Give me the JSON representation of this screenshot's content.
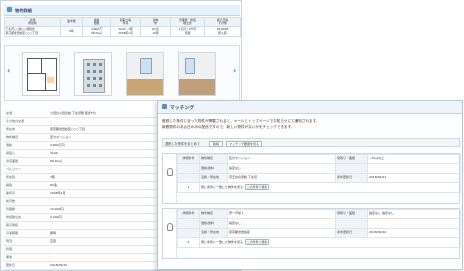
{
  "back_panel": {
    "title": "物件詳細",
    "summary_headers": [
      "交通\n所在地",
      "築年数",
      "価格\n面積",
      "間取り等\n年月",
      "建物\n他",
      "管理費・修繕\n積立金",
      "販売日等\nその他"
    ],
    "summary_values": [
      "下北沢○○線○○駅徒歩\n東京都世田谷区○○○丁目",
      "8年",
      "4,800万\n68.00㎡",
      "3LDK / 3階\n2008年1月",
      "RC造\n10階",
      "1万円 / 9千円\n月額",
      "2018/09\n即入居"
    ],
    "detail_rows": [
      {
        "label": "交通",
        "value": "小田急小田急線 下北沢駅 徒歩5分"
      },
      {
        "label": "その他の交通",
        "value": "-"
      },
      {
        "label": "所在地",
        "value": "東京都世田谷区○○○丁目"
      },
      {
        "label": "物件種目",
        "value": "区分マンション"
      },
      {
        "label": "価格",
        "value": "4,800万円"
      },
      {
        "label": "間取り",
        "value": "3LDK"
      },
      {
        "label": "専有面積",
        "value": "68.00㎡"
      },
      {
        "label": "バルコニー",
        "value": "-"
      },
      {
        "label": "所在階",
        "value": "3階"
      },
      {
        "label": "構造",
        "value": "RC造"
      },
      {
        "label": "築年月",
        "value": "2008年1月"
      },
      {
        "label": "総戸数",
        "value": "-"
      },
      {
        "label": "管理費",
        "value": "10,000円"
      },
      {
        "label": "修繕積立金",
        "value": "9,000円"
      },
      {
        "label": "取引態様",
        "value": "-"
      },
      {
        "label": "引渡時期",
        "value": "即時"
      },
      {
        "label": "現況",
        "value": "空室"
      },
      {
        "label": "管理",
        "value": "-"
      },
      {
        "label": "備考",
        "value": "-"
      },
      {
        "label": "更新日",
        "value": "2018/09/20"
      }
    ],
    "gallery": {
      "prev_label": "‹",
      "next_label": "›"
    }
  },
  "matching": {
    "title": "マッチング",
    "desc1": "登録した条件に合った物件が掲載されると、メールとトップページでお知らせにて通知されます。",
    "desc2": "新着物件のある日のみの配信ですので、新しい物件がないかをチェックできます。",
    "toolbar": {
      "label": "選択した条件をまとめて",
      "delete_button": "削除",
      "history_button": "マッチング履歴を見る"
    },
    "cards": [
      {
        "index": "1",
        "rows": [
          {
            "c1": "詳細条件",
            "c2": "物件種目",
            "c3": "区分マンション",
            "c4": "間取り・面積",
            "c5": "~70㎡以上"
          },
          {
            "c1": "",
            "c2": "価格/賃料",
            "c3": "指定なし",
            "c4": "",
            "c5": ""
          },
          {
            "c1": "",
            "c2": "沿線・所在地",
            "c3": "京王井の頭線 下北沢",
            "c4": "条件更新日",
            "c5": "2018/09/21"
          },
          {
            "c1": "",
            "c2": "",
            "c3": "",
            "c4": "",
            "c5": ""
          }
        ],
        "footer_label": "既に条件に一致した物件を見る",
        "footer_button": "この条件で検索"
      },
      {
        "index": "2",
        "rows": [
          {
            "c1": "詳細条件",
            "c2": "物件種目",
            "c3": "売一戸建て",
            "c4": "間取り・面積",
            "c5": "指定なし 指定なし"
          },
          {
            "c1": "",
            "c2": "価格/賃料",
            "c3": "指定なし",
            "c4": "",
            "c5": ""
          },
          {
            "c1": "",
            "c2": "沿線・所在地",
            "c3": "東京都世田谷区",
            "c4": "条件更新日",
            "c5": "2018/09/20"
          },
          {
            "c1": "",
            "c2": "",
            "c3": "",
            "c4": "",
            "c5": ""
          }
        ],
        "footer_label": "既に条件に一致した物件を見る",
        "footer_button": "この条件で検索"
      }
    ]
  }
}
